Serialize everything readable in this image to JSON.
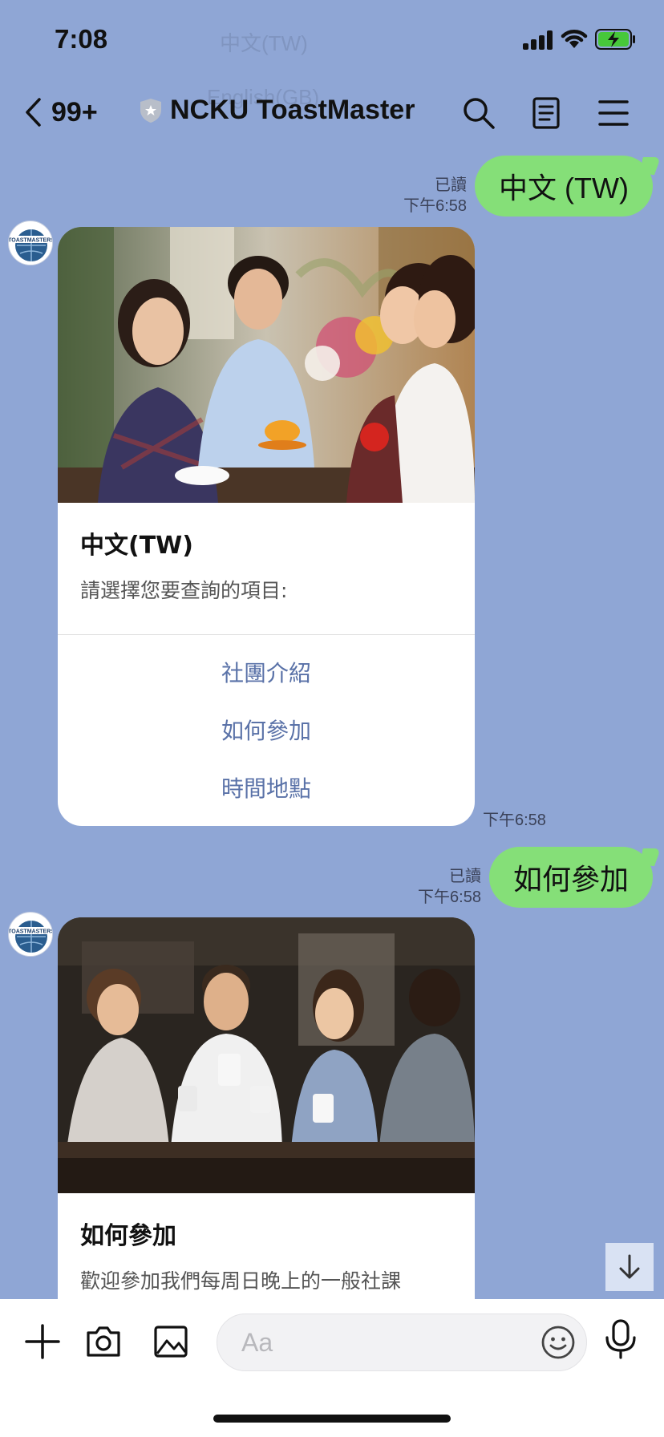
{
  "status_bar": {
    "time": "7:08"
  },
  "ghost_texts": [
    "中文(TW)",
    "English(GB)"
  ],
  "header": {
    "back_count": "99+",
    "title": "NCKU ToastMaster"
  },
  "messages": {
    "sent1": {
      "read": "已讀",
      "time": "下午6:58",
      "text": "中文 (TW)"
    },
    "card1": {
      "title": "中文(TW)",
      "subtitle": "請選擇您要查詢的項目:",
      "actions": [
        "社團介紹",
        "如何參加",
        "時間地點"
      ],
      "time": "下午6:58"
    },
    "sent2": {
      "read": "已讀",
      "time": "下午6:58",
      "text": "如何參加"
    },
    "card2": {
      "title": "如何參加",
      "subtitle": "歡迎參加我們每周日晚上的一般社課"
    }
  },
  "input": {
    "placeholder": "Aa"
  },
  "colors": {
    "background": "#8fa6d5",
    "sent_bubble": "#85df78",
    "action_text": "#5a72a8"
  }
}
